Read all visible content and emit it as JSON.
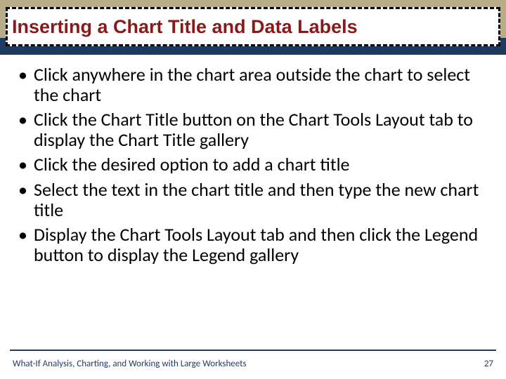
{
  "title": "Inserting a Chart Title and Data Labels",
  "bullets": [
    "Click anywhere in the chart area outside the chart to select the chart",
    "Click the Chart Title button on the Chart Tools Layout tab to display the Chart Title gallery",
    "Click the desired option to add a chart title",
    "Select the text in the chart title and then type the new chart title",
    "Display the Chart Tools Layout tab and then click the Legend button to display the Legend gallery"
  ],
  "footer": {
    "left": "What-If Analysis, Charting, and Working with Large Worksheets",
    "right": "27"
  }
}
